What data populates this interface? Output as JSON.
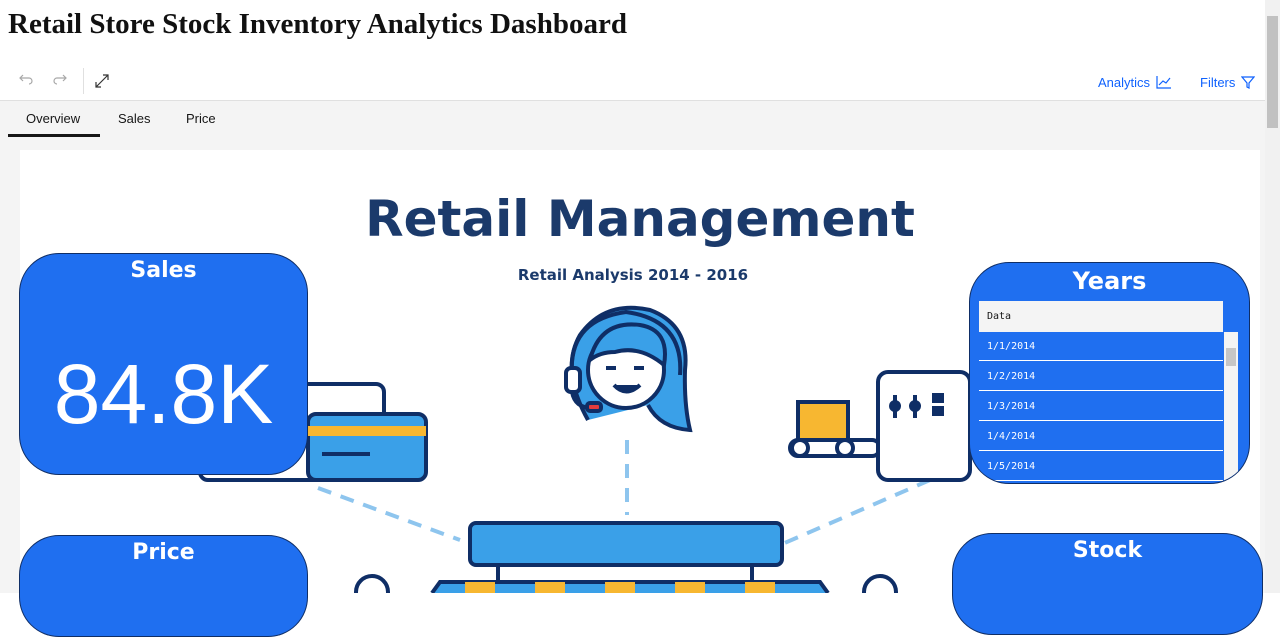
{
  "page": {
    "title": "Retail Store Stock Inventory Analytics Dashboard"
  },
  "toolbar": {
    "undo_icon": "undo-icon",
    "redo_icon": "redo-icon",
    "fullscreen_icon": "expand-icon",
    "analytics_label": "Analytics",
    "filters_label": "Filters",
    "link_color": "#0f62fe"
  },
  "tabs": [
    {
      "label": "Overview",
      "selected": true
    },
    {
      "label": "Sales",
      "selected": false
    },
    {
      "label": "Price",
      "selected": false
    }
  ],
  "dashboard": {
    "title": "Retail Management",
    "subtitle": "Retail Analysis 2014 - 2016",
    "accent_color": "#1f6ff0",
    "title_color": "#1b3a6b",
    "sales": {
      "title": "Sales",
      "value": "84.8K"
    },
    "price": {
      "title": "Price"
    },
    "stock": {
      "title": "Stock"
    },
    "years": {
      "title": "Years",
      "column": "Data",
      "rows": [
        "1/1/2014",
        "1/2/2014",
        "1/3/2014",
        "1/4/2014",
        "1/5/2014"
      ]
    }
  }
}
